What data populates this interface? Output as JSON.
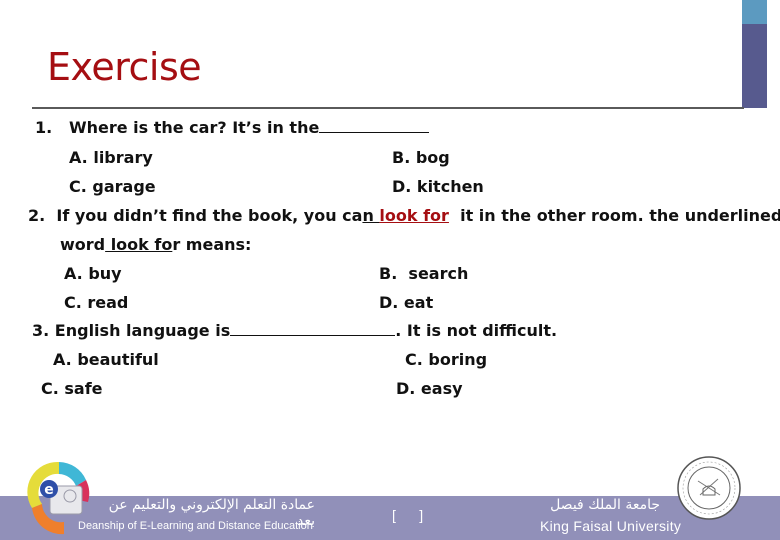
{
  "slide": {
    "title": "Exercise",
    "accent_colors": {
      "top": "#5c9ac0",
      "main": "#575a8e",
      "title": "#a50e12",
      "footer": "#9190b9"
    }
  },
  "questions": [
    {
      "number": "1.",
      "text_before": "Where is the car? It’s in the",
      "text_after": "",
      "options": {
        "A": "A. library",
        "B": "B. bog",
        "C": "C. garage",
        "D": "D. kitchen"
      }
    },
    {
      "number": "2.",
      "text_before": "If you didn’t find the book, you ca",
      "underline_lead": "n ",
      "highlight": "look for",
      "text_after": "  it in the other room. the underlined",
      "line2_before": "word",
      "line2_underlined": " look fo",
      "line2_after": "r means:",
      "options": {
        "A": "A. buy",
        "B": "B.  search",
        "C": "C. read",
        "D": "D. eat"
      }
    },
    {
      "number": "3.",
      "text_before": "English language is",
      "text_after": ". It is not difficult.",
      "options": {
        "A": "A. beautiful",
        "B": "C. boring",
        "C": "C. safe",
        "D": "D. easy"
      }
    }
  ],
  "footer": {
    "deanship_ar": "عمادة التعلم الإلكتروني والتعليم عن بعد",
    "deanship_en": "Deanship of E-Learning and Distance Education",
    "page_brackets": "[      ]",
    "university_ar": "جامعة الملك فيصل",
    "university_en": "King Faisal University",
    "left_logo": "e-learning-logo-icon",
    "right_logo": "university-seal-icon"
  }
}
